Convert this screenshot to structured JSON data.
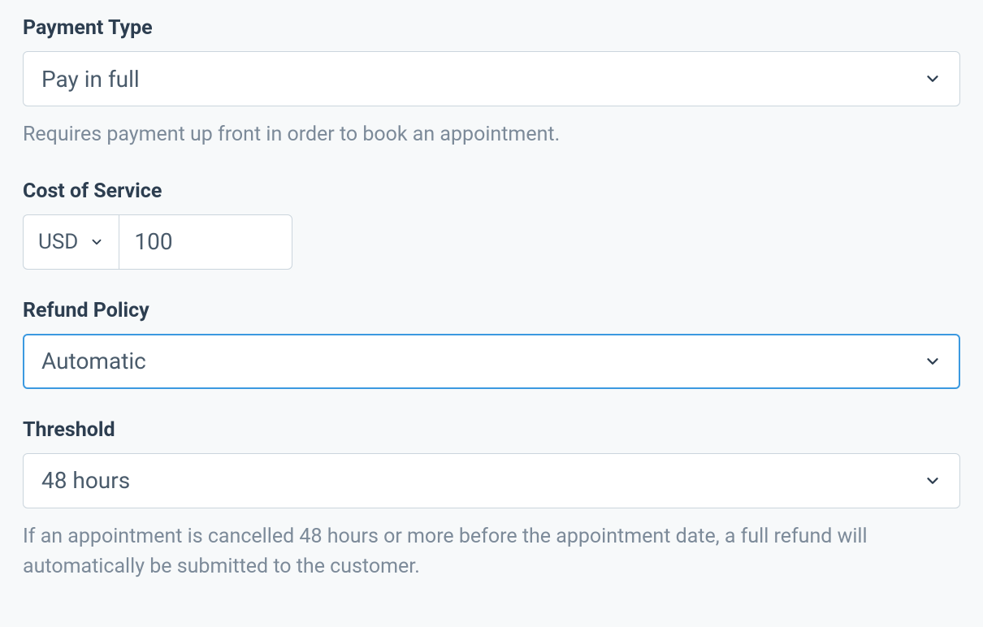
{
  "paymentType": {
    "label": "Payment Type",
    "value": "Pay in full",
    "helper": "Requires payment up front in order to book an appointment."
  },
  "costOfService": {
    "label": "Cost of Service",
    "currency": "USD",
    "amount": "100"
  },
  "refundPolicy": {
    "label": "Refund Policy",
    "value": "Automatic"
  },
  "threshold": {
    "label": "Threshold",
    "value": "48 hours",
    "helper": "If an appointment is cancelled 48 hours or more before the appointment date, a full refund will automatically be submitted to the customer."
  }
}
